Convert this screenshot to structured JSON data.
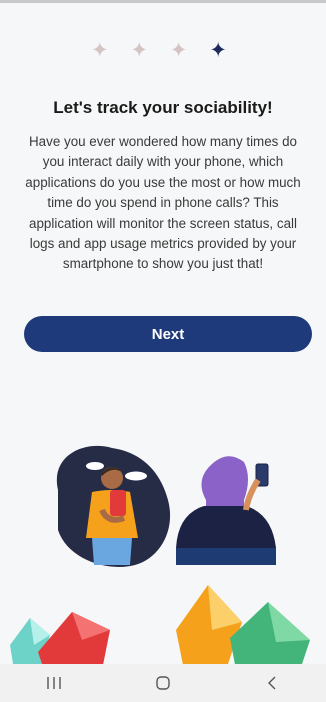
{
  "onboarding": {
    "stars": [
      "✦",
      "✦",
      "✦",
      "✦"
    ],
    "title": "Let's track your sociability!",
    "description": "Have you ever wondered how many times do you interact daily with your phone, which applications do you use the most or how much time do you spend in phone calls? This application will monitor the screen status, call logs and app usage metrics provided by your smartphone to show you just that!",
    "next_label": "Next"
  },
  "colors": {
    "accent": "#1e3a7b",
    "star_inactive": "#d6c3c3",
    "star_active": "#1e2a5a"
  },
  "navbar": {
    "icons": [
      "recent-apps-icon",
      "home-icon",
      "back-icon"
    ]
  }
}
